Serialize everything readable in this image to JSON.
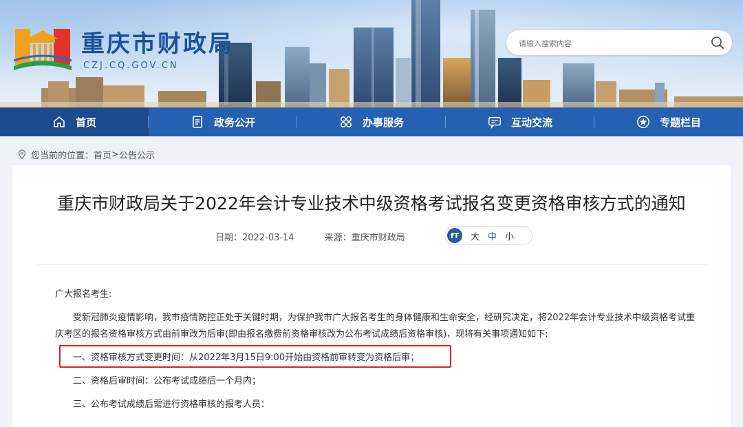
{
  "header": {
    "site_name": "重庆市财政局",
    "domain": "CZJ.CQ.GOV.CN",
    "search_placeholder": "请输入搜索内容"
  },
  "nav": [
    {
      "label": "首页",
      "icon": "home-icon",
      "active": true
    },
    {
      "label": "政务公开",
      "icon": "document-icon"
    },
    {
      "label": "办事服务",
      "icon": "grid-icon"
    },
    {
      "label": "互动交流",
      "icon": "chat-icon"
    },
    {
      "label": "专题栏目",
      "icon": "star-icon"
    }
  ],
  "breadcrumb": {
    "prefix": "您当前的位置：",
    "home": "首页",
    "sep": ">",
    "current": "公告公示"
  },
  "article": {
    "title": "重庆市财政局关于2022年会计专业技术中级资格考试报名变更资格审核方式的通知",
    "date": "日期：2022-03-14",
    "source": "来源：重庆市财政局",
    "font_icon": "fT",
    "font_sizes": [
      "大",
      "中",
      "小"
    ],
    "greeting": "广大报名考生:",
    "intro": "受新冠肺炎疫情影响，我市疫情防控正处于关键时期，为保护我市广大报名考生的身体健康和生命安全，经研究决定，将2022年会计专业技术中级资格考试重庆考区的报名资格审核方式由前审改为后审(即由报名缴费前资格审核改为公布考试成绩后资格审核)，现将有关事项通知如下:",
    "items": [
      "一、资格审核方式变更时间：从2022年3月15日9:00开始由资格前审转变为资格后审；",
      "二、资格后审时间：公布考试成绩后一个月内；",
      "三、公布考试成绩后需进行资格审核的报考人员："
    ]
  },
  "colors": {
    "nav_bg": "#2660b0",
    "nav_active": "#1c4a8e",
    "title_blue": "#1d4f9c",
    "highlight": "#e02020"
  }
}
